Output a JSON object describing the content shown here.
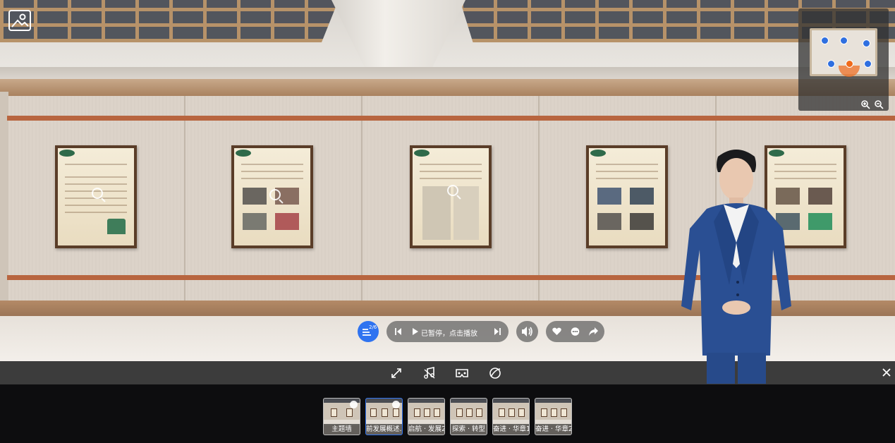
{
  "player": {
    "status_text": "已暂停，点击播放",
    "playlist_position": "2/6"
  },
  "colors": {
    "accent": "#2f73f0",
    "current_position": "#ef6a1b"
  },
  "icons": {
    "gallery": "gallery-icon",
    "zoom_in": "zoom-in-icon",
    "zoom_out": "zoom-out-icon",
    "playlist": "playlist-icon",
    "prev": "skip-previous-icon",
    "play": "play-icon",
    "next": "skip-next-icon",
    "volume": "volume-icon",
    "like": "heart-icon",
    "comment": "comment-icon",
    "share": "share-icon",
    "fullscreen": "fullscreen-icon",
    "music": "music-off-icon",
    "vr": "vr-glasses-icon",
    "gyro": "gyroscope-icon",
    "close": "close-icon"
  },
  "scenes": [
    {
      "label": "主题墙",
      "visited": true,
      "active": false
    },
    {
      "label": "前发展概述...",
      "visited": true,
      "active": true
    },
    {
      "label": "启航 · 发展2",
      "visited": false,
      "active": false
    },
    {
      "label": "探索 · 转型",
      "visited": false,
      "active": false
    },
    {
      "label": "奋进 · 华章1",
      "visited": false,
      "active": false
    },
    {
      "label": "奋进 · 华章2...",
      "visited": false,
      "active": false
    }
  ]
}
